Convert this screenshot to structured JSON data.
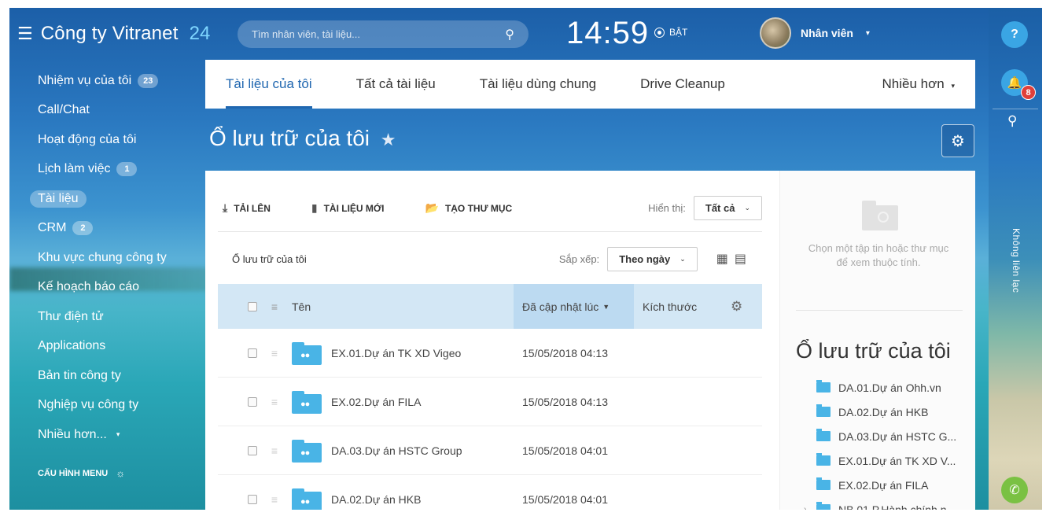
{
  "header": {
    "brand_name": "Công ty Vitranet",
    "brand_number": "24",
    "search_placeholder": "Tìm nhân viên, tài liệu...",
    "clock": "14:59",
    "status_label": "BẬT",
    "user_name": "Nhân viên"
  },
  "sidebar": {
    "items": [
      {
        "label": "Nhiệm vụ của tôi",
        "badge": "23"
      },
      {
        "label": "Call/Chat",
        "badge": ""
      },
      {
        "label": "Hoạt động của tôi",
        "badge": ""
      },
      {
        "label": "Lịch làm việc",
        "badge": "1"
      },
      {
        "label": "Tài liệu",
        "badge": ""
      },
      {
        "label": "CRM",
        "badge": "2"
      },
      {
        "label": "Khu vực chung công ty",
        "badge": ""
      },
      {
        "label": "Kế hoạch báo cáo",
        "badge": ""
      },
      {
        "label": "Thư điện tử",
        "badge": ""
      },
      {
        "label": "Applications",
        "badge": ""
      },
      {
        "label": "Bản tin công ty",
        "badge": ""
      },
      {
        "label": "Nghiệp vụ công ty",
        "badge": ""
      },
      {
        "label": "Nhiều hơn...",
        "badge": ""
      }
    ],
    "config_label": "CẤU HÌNH MENU"
  },
  "tabs": {
    "items": [
      "Tài liệu của tôi",
      "Tất cả tài liệu",
      "Tài liệu dùng chung",
      "Drive Cleanup"
    ],
    "more": "Nhiều hơn"
  },
  "page": {
    "title": "Ổ lưu trữ của tôi"
  },
  "toolbar": {
    "upload": "TẢI LÊN",
    "new_doc": "TÀI LIỆU MỚI",
    "new_folder": "TẠO THƯ MỤC",
    "view_label": "Hiển thị:",
    "view_value": "Tất cả"
  },
  "subbar": {
    "breadcrumb": "Ổ lưu trữ của tôi",
    "sort_label": "Sắp xếp:",
    "sort_value": "Theo ngày"
  },
  "table": {
    "headers": {
      "name": "Tên",
      "updated": "Đã cập nhật lúc",
      "size": "Kích thước"
    },
    "rows": [
      {
        "name": "EX.01.Dự án TK XD Vigeo",
        "updated": "15/05/2018 04:13",
        "size": ""
      },
      {
        "name": "EX.02.Dự án FILA",
        "updated": "15/05/2018 04:13",
        "size": ""
      },
      {
        "name": "DA.03.Dự án HSTC Group",
        "updated": "15/05/2018 04:01",
        "size": ""
      },
      {
        "name": "DA.02.Dự án HKB",
        "updated": "15/05/2018 04:01",
        "size": ""
      }
    ]
  },
  "side": {
    "hint_line1": "Chọn một tập tin hoặc thư mục",
    "hint_line2": "để xem thuộc tính.",
    "title": "Ổ lưu trữ của tôi",
    "tree": [
      "DA.01.Dự án Ohh.vn",
      "DA.02.Dự án HKB",
      "DA.03.Dự án HSTC G...",
      "EX.01.Dự án TK XD V...",
      "EX.02.Dự án FILA",
      "NB.01.P.Hành chính n..."
    ]
  },
  "strip": {
    "help": "?",
    "notifications": "8",
    "vertical_text": "Không liên lạc"
  }
}
